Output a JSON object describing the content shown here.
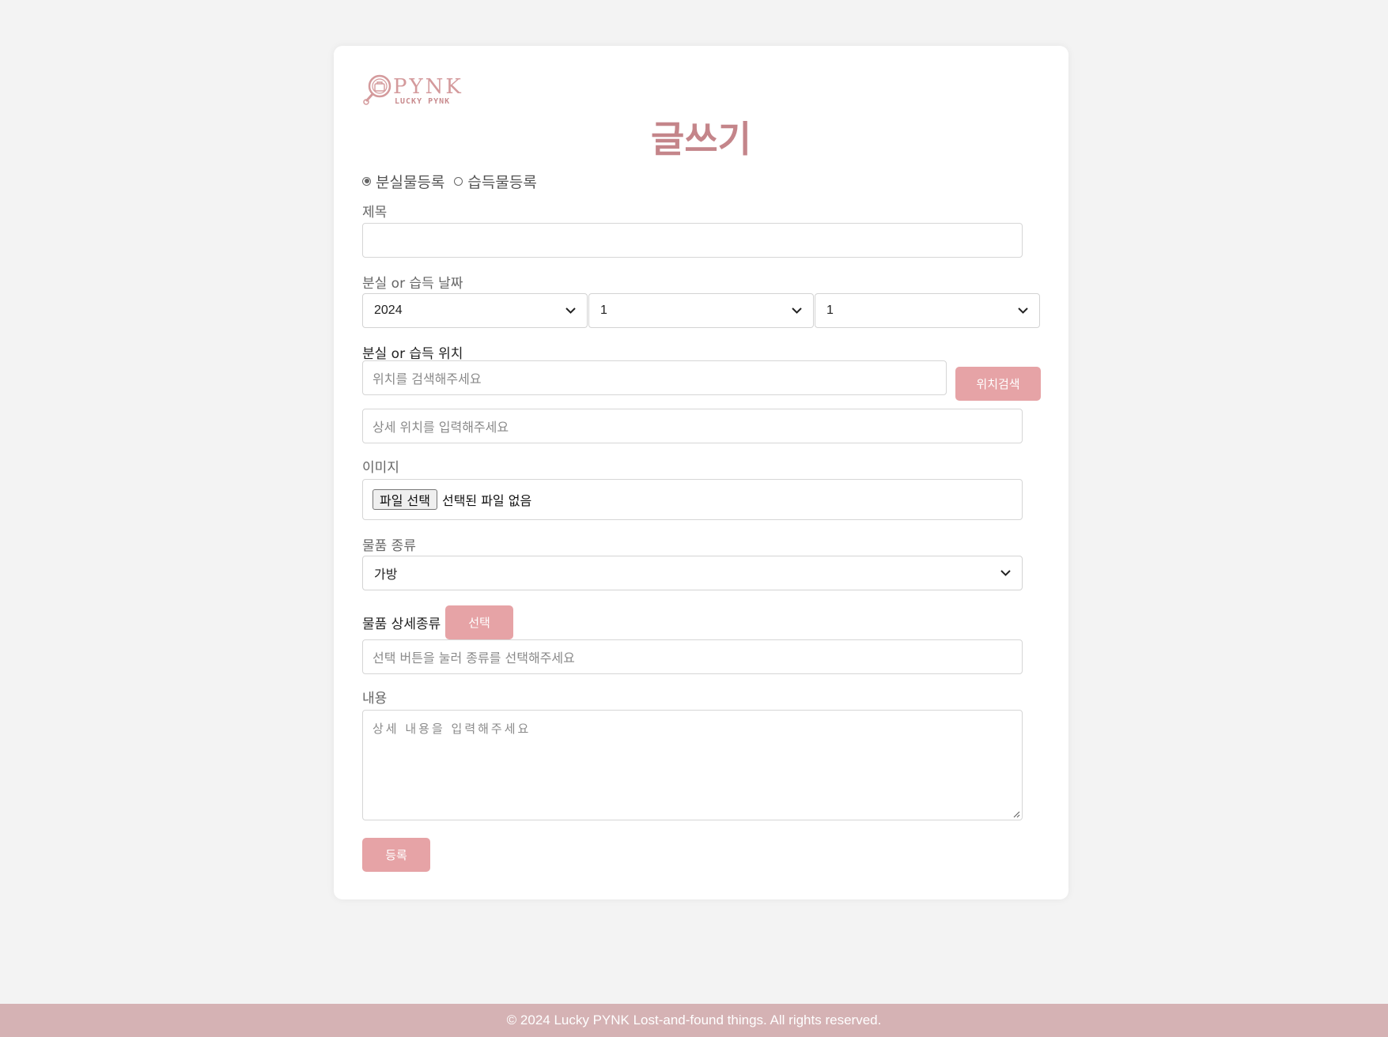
{
  "logo": {
    "name": "PYNK",
    "subtitle": "LUCKY PYNK"
  },
  "page_title": "글쓰기",
  "post_type": {
    "options": [
      "분실물등록",
      "습득물등록"
    ],
    "selected": "분실물등록"
  },
  "title_field": {
    "label": "제목",
    "value": ""
  },
  "date_field": {
    "label": "분실 or 습득 날짜",
    "year": "2024",
    "month": "1",
    "day": "1"
  },
  "location_field": {
    "label": "분실 or 습득 위치",
    "search_placeholder": "위치를 검색해주세요",
    "search_button": "위치검색",
    "detail_placeholder": "상세 위치를 입력해주세요"
  },
  "image_field": {
    "label": "이미지",
    "file_button": "파일 선택",
    "file_status": "선택된 파일 없음"
  },
  "category_field": {
    "label": "물품 종류",
    "selected": "가방"
  },
  "subcategory_field": {
    "label": "물품 상세종류",
    "select_button": "선택",
    "placeholder": "선택 버튼을 눌러 종류를 선택해주세요"
  },
  "content_field": {
    "label": "내용",
    "placeholder": "상세 내용을 입력해주세요"
  },
  "submit_button": "등록",
  "footer": {
    "text": "© 2024 Lucky PYNK Lost-and-found things. All rights reserved."
  },
  "colors": {
    "accent": "#e6a3a6",
    "title": "#c4858a",
    "footer_bg": "#d5b2b4"
  }
}
